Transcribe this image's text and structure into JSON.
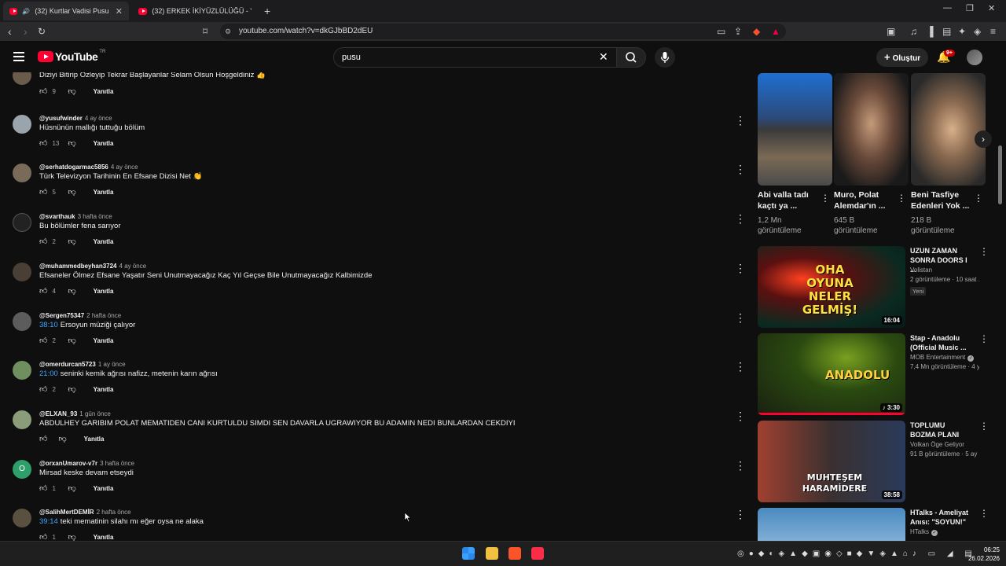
{
  "browser": {
    "tabs": [
      {
        "label": "(32) Kurtlar Vadisi Pusu | 179...",
        "active": true
      },
      {
        "label": "(32) ERKEK İKİYÜZLÜLÜĞÜ - YouTube",
        "active": false
      }
    ],
    "url": "youtube.com/watch?v=dkGJbBD2dEU"
  },
  "masthead": {
    "logo_text": "YouTube",
    "logo_country": "TR",
    "search_value": "pusu",
    "create_label": "Oluştur",
    "notification_count": "9+"
  },
  "comments": [
    {
      "handle": "",
      "time": "",
      "text": "Diziyi Bitirip Özleyip Tekrar Başlayanlar Selam Olsun Hoşgeldiniz 👍",
      "timestamp": "",
      "likes": "9",
      "reply": "Yanıtla"
    },
    {
      "handle": "@yusufwinder",
      "time": "4 ay önce",
      "text": "Hüsnünün mallığı tuttuğu bölüm",
      "timestamp": "",
      "likes": "13",
      "reply": "Yanıtla"
    },
    {
      "handle": "@serhatdogarmac5856",
      "time": "4 ay önce",
      "text": "Türk Televizyon Tarihinin En Efsane Dizisi Net 👏",
      "timestamp": "",
      "likes": "5",
      "reply": "Yanıtla"
    },
    {
      "handle": "@svarthauk",
      "time": "3 hafta önce",
      "text": "Bu bölümler fena sarıyor",
      "timestamp": "",
      "likes": "2",
      "reply": "Yanıtla"
    },
    {
      "handle": "@muhammedbeyhan3724",
      "time": "4 ay önce",
      "text": "Efsaneler Ölmez Efsane Yaşatır Seni Unutmayacağız Kaç Yıl Geçse Bile Unutmayacağız Kalbimizde",
      "timestamp": "",
      "likes": "4",
      "reply": "Yanıtla"
    },
    {
      "handle": "@Sergen75347",
      "time": "2 hafta önce",
      "text": "Ersoyun müziği çalıyor",
      "timestamp": "38:10",
      "likes": "2",
      "reply": "Yanıtla"
    },
    {
      "handle": "@omerdurcan5723",
      "time": "1 ay önce",
      "text": "seninki kemik ağrısı nafizz, metenin karın ağrısı",
      "timestamp": "21:00",
      "likes": "2",
      "reply": "Yanıtla"
    },
    {
      "handle": "@ELXAN_93",
      "time": "1 gün önce",
      "text": "ABDULHEY GARIBIM POLAT MEMATIDEN CANI KURTULDU SIMDI SEN DAVARLA UGRAWIYOR BU ADAMIN NEDI BUNLARDAN CEKDIYI",
      "timestamp": "",
      "likes": "",
      "reply": "Yanıtla"
    },
    {
      "handle": "@orxanUmarov-v7r",
      "time": "3 hafta önce",
      "text": "Mirsad keske devam etseydi",
      "timestamp": "",
      "likes": "1",
      "reply": "Yanıtla"
    },
    {
      "handle": "@SalihMertDEMİR",
      "time": "2 hafta önce",
      "text": "teki mematinin silahı mı eğer oysa ne alaka",
      "timestamp": "39:14",
      "likes": "1",
      "reply": "Yanıtla"
    }
  ],
  "shorts": [
    {
      "title": "Abi valla tadı kaçtı ya ...",
      "views": "1,2 Mn görüntüleme"
    },
    {
      "title": "Muro, Polat Alemdar'ın ...",
      "views": "645 B görüntüleme"
    },
    {
      "title": "Beni Tasfiye Edenleri Yok ...",
      "views": "218 B görüntüleme"
    }
  ],
  "recommendations": [
    {
      "title": "UZUN ZAMAN SONRA DOORS I ...",
      "channel": "Volistan",
      "meta": "2 görüntüleme · 10 saat ...",
      "badge": "Yeni",
      "duration": "16:04",
      "thumb_text": "OHA OYUNA NELER GELMİŞ!"
    },
    {
      "title": "Stap - Anadolu (Official Music ...",
      "channel": "MOB Entertainment",
      "meta": "7,4 Mn görüntüleme · 4 yı...",
      "badge": "",
      "duration": "3:30",
      "thumb_text": "ANADOLU"
    },
    {
      "title": "TOPLUMU BOZMA PLANI",
      "channel": "Volkan Öge Geliyor",
      "meta": "91 B görüntüleme · 5 ay ...",
      "badge": "",
      "duration": "38:58",
      "thumb_text": "MUHTEŞEM HARAMİDERE"
    },
    {
      "title": "HTalks - Ameliyat Anısı: \"SOYUN!\"",
      "channel": "HTalks",
      "meta": "",
      "badge": "",
      "duration": "",
      "thumb_text": ""
    }
  ],
  "taskbar": {
    "time": "06:25",
    "date": "26.02.2026"
  },
  "colors": {
    "accent": "#ff0033",
    "link": "#3ea6ff",
    "background": "#0f0f0f"
  }
}
